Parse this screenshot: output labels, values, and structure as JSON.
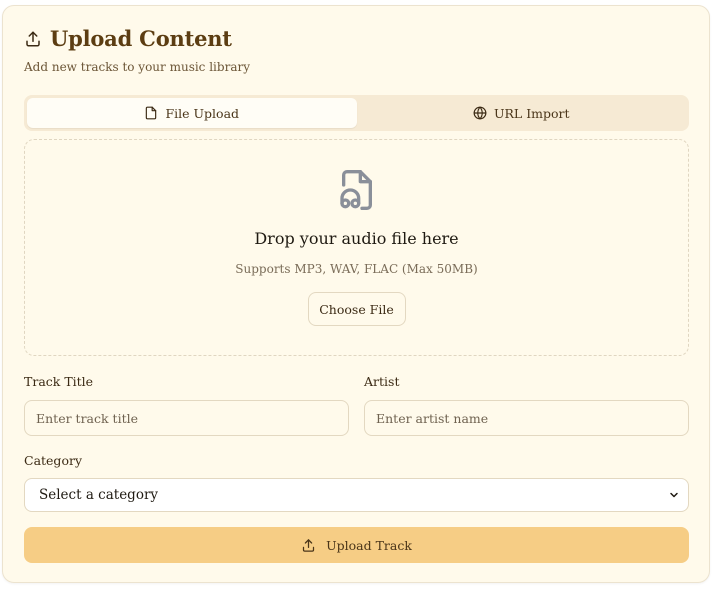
{
  "header": {
    "title": "Upload Content",
    "subtitle": "Add new tracks to your music library",
    "icon": "upload-icon"
  },
  "tabs": [
    {
      "label": "File Upload",
      "icon": "file-icon",
      "active": true
    },
    {
      "label": "URL Import",
      "icon": "globe-icon",
      "active": false
    }
  ],
  "dropzone": {
    "icon": "audio-file-icon",
    "heading": "Drop your audio file here",
    "subtext": "Supports MP3, WAV, FLAC (Max 50MB)",
    "button_label": "Choose File"
  },
  "form": {
    "track_title": {
      "label": "Track Title",
      "placeholder": "Enter track title",
      "value": ""
    },
    "artist": {
      "label": "Artist",
      "placeholder": "Enter artist name",
      "value": ""
    },
    "category": {
      "label": "Category",
      "selected": "Select a category"
    }
  },
  "submit": {
    "label": "Upload Track",
    "icon": "upload-icon"
  },
  "colors": {
    "card_bg": "#fffaeb",
    "tab_bar_bg": "#f6ead4",
    "primary_button_bg": "#f6cd85",
    "title_color": "#5c3d12",
    "border": "#e3d8c1"
  }
}
